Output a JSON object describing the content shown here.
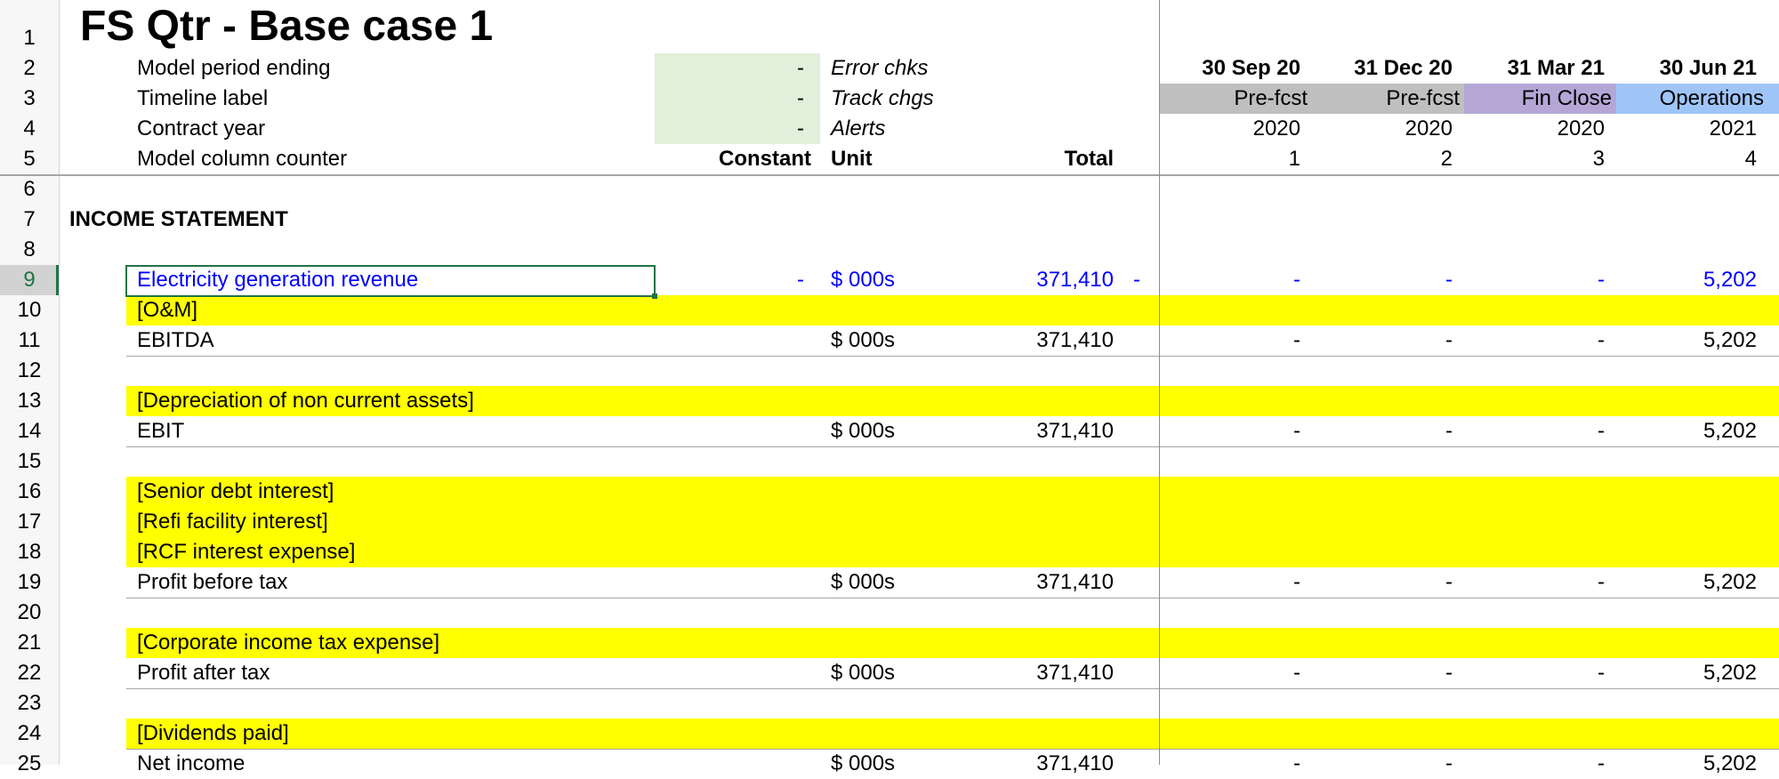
{
  "sheet": {
    "title": "FS Qtr - Base case 1",
    "row_numbers": [
      "1",
      "2",
      "3",
      "4",
      "5",
      "6",
      "7",
      "8",
      "9",
      "10",
      "11",
      "12",
      "13",
      "14",
      "15",
      "16",
      "17",
      "18",
      "19",
      "20",
      "21",
      "22",
      "23",
      "24",
      "25"
    ]
  },
  "header": {
    "labels": {
      "period": "Model period ending",
      "timeline": "Timeline label",
      "contract": "Contract year",
      "counter": "Model column counter"
    },
    "input_values": [
      "-",
      "-",
      "-"
    ],
    "flags": {
      "error": "Error chks",
      "track": "Track chgs",
      "alerts": "Alerts"
    },
    "col_headers": {
      "constant": "Constant",
      "unit": "Unit",
      "total": "Total"
    },
    "periods": [
      {
        "date": "30 Sep 20",
        "label": "Pre-fcst",
        "year": "2020",
        "counter": "1",
        "color": "#bfbfbf"
      },
      {
        "date": "31 Dec 20",
        "label": "Pre-fcst",
        "year": "2020",
        "counter": "2",
        "color": "#bfbfbf"
      },
      {
        "date": "31 Mar 21",
        "label": "Fin Close",
        "year": "2020",
        "counter": "3",
        "color": "#b4a7d6"
      },
      {
        "date": "30 Jun 21",
        "label": "Operations",
        "year": "2021",
        "counter": "4",
        "color": "#9fc5f8"
      }
    ]
  },
  "income_statement": {
    "heading": "INCOME STATEMENT",
    "revenue": {
      "label": "Electricity generation revenue",
      "constant": "-",
      "unit": "$ 000s",
      "total": "371,410",
      "flag": "-",
      "values": [
        "-",
        "-",
        "-",
        "5,202"
      ]
    },
    "om": "[O&M]",
    "ebitda": {
      "label": "EBITDA",
      "unit": "$ 000s",
      "total": "371,410",
      "values": [
        "-",
        "-",
        "-",
        "5,202"
      ]
    },
    "depreciation": "[Depreciation of non current assets]",
    "ebit": {
      "label": "EBIT",
      "unit": "$ 000s",
      "total": "371,410",
      "values": [
        "-",
        "-",
        "-",
        "5,202"
      ]
    },
    "senior_interest": "[Senior debt interest]",
    "refi_interest": "[Refi facility interest]",
    "rcf_interest": "[RCF interest expense]",
    "pbt": {
      "label": "Profit before tax",
      "unit": "$ 000s",
      "total": "371,410",
      "values": [
        "-",
        "-",
        "-",
        "5,202"
      ]
    },
    "tax": "[Corporate income tax expense]",
    "pat": {
      "label": "Profit after tax",
      "unit": "$ 000s",
      "total": "371,410",
      "values": [
        "-",
        "-",
        "-",
        "5,202"
      ]
    },
    "dividends": "[Dividends paid]",
    "net_income": {
      "label": "Net income",
      "unit": "$ 000s",
      "total": "371,410",
      "values": [
        "-",
        "-",
        "-",
        "5,202"
      ]
    }
  },
  "colors": {
    "yellow_band": "#ffff00",
    "input_green": "#e2efda",
    "selected_cell_border": "#217346",
    "row_header_bg": "#f3f3f3",
    "blue_input_text": "#0000ff"
  }
}
